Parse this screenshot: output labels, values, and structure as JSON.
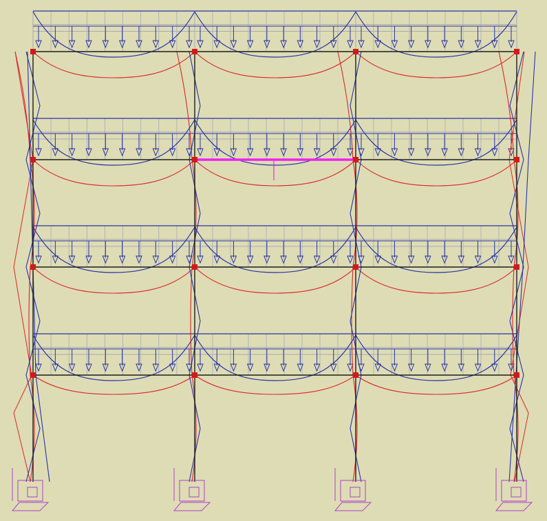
{
  "viewport": {
    "background": "#dedcb4",
    "description_visible_text": ""
  },
  "structure": {
    "bays": 3,
    "stories": 4,
    "supports": "fixed",
    "selected_member": "floor-2-bay-2-beam"
  },
  "colors": {
    "frame": "#1c1c1c",
    "load": "#2632a8",
    "load_grid": "#a8aab8",
    "deflection": "#d8262a",
    "node": "#d11a1a",
    "selected_beam": "#ee22ee",
    "support": "#b040c8"
  },
  "icons": {
    "node": "joint-node-icon",
    "support": "fixed-support-icon",
    "load_arrow": "distributed-load-arrow-icon"
  }
}
